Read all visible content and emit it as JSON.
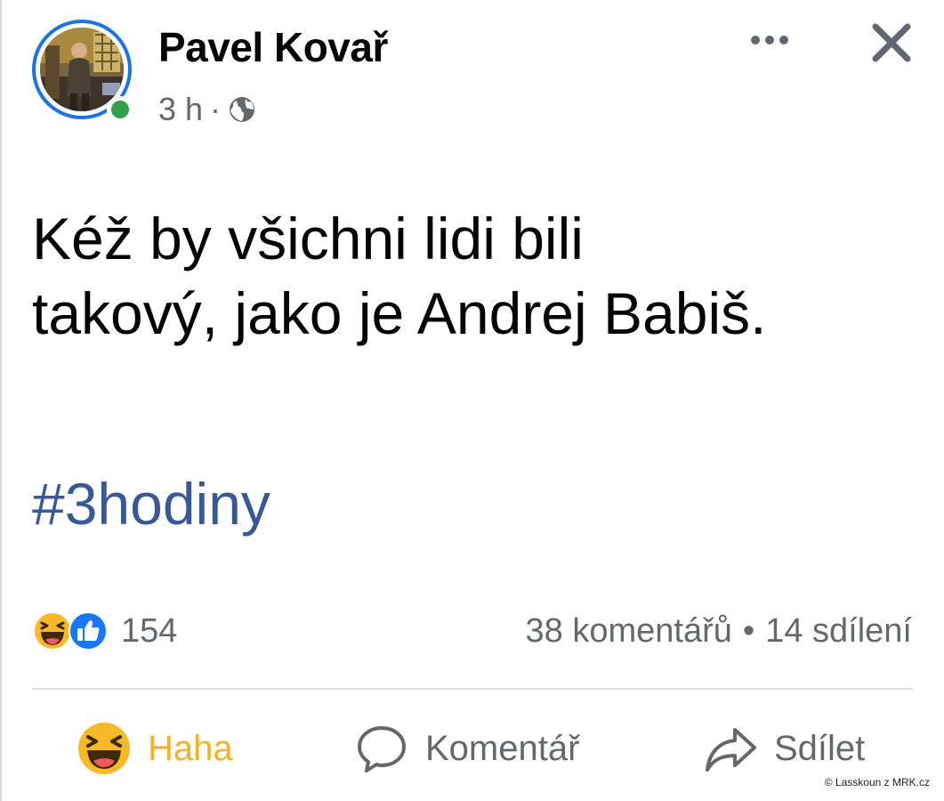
{
  "post": {
    "author": {
      "name": "Pavel Kovař",
      "online": true
    },
    "time": "3 h",
    "separator": "·",
    "audience_icon": "globe-icon",
    "text_lines": [
      "Kéž by všichni lidi bili",
      "takový, jako je Andrej Babiš."
    ],
    "hashtag": "#3hodiny"
  },
  "reactions": {
    "icons": [
      "haha-reaction-icon",
      "like-reaction-icon"
    ],
    "count": "154"
  },
  "stats": {
    "comments": "38 komentářů",
    "dot": "•",
    "shares": "14 sdílení"
  },
  "actions": {
    "reaction": {
      "label": "Haha",
      "icon": "haha-icon"
    },
    "comment": {
      "label": "Komentář",
      "icon": "comment-icon"
    },
    "share": {
      "label": "Sdílet",
      "icon": "share-icon"
    }
  },
  "watermark": "© Lasskoun z MRK.cz",
  "colors": {
    "accent_blue": "#1b74e4",
    "online_green": "#31a24c",
    "hashtag": "#385898",
    "secondary_text": "#65676b",
    "haha_yellow": "#f7b125"
  }
}
